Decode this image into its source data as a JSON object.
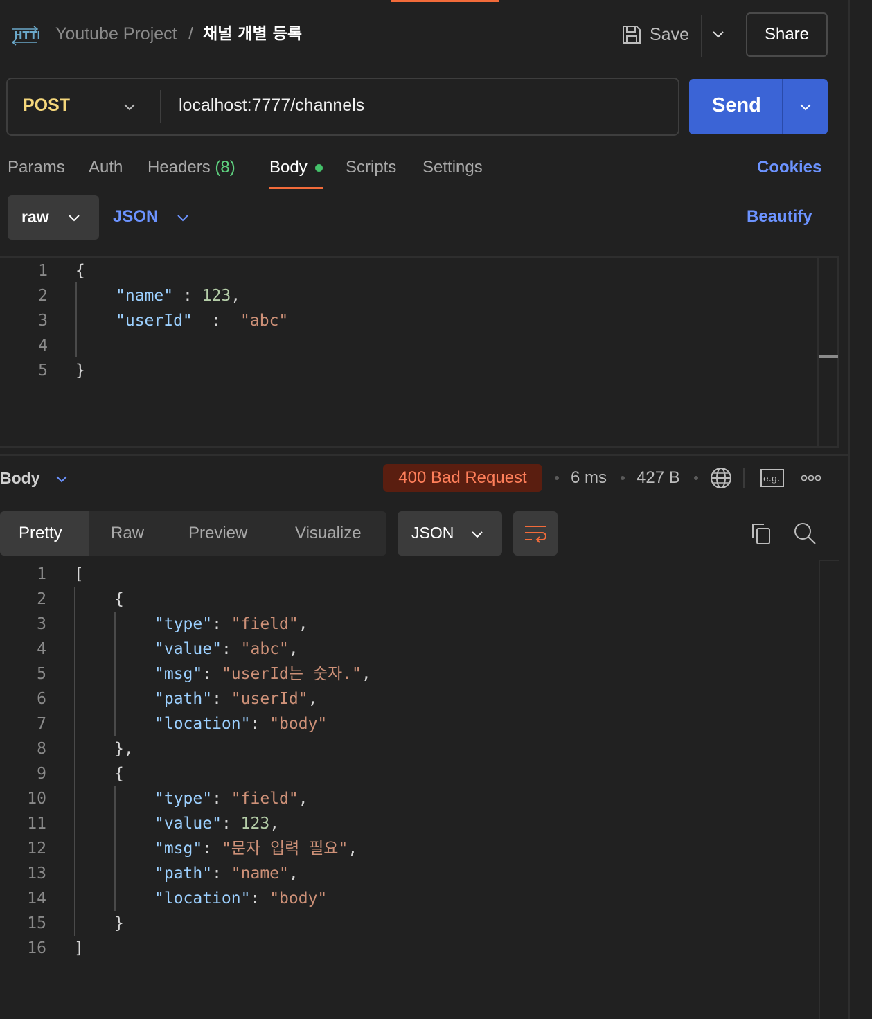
{
  "header": {
    "project": "Youtube Project",
    "separator": "/",
    "title": "채널 개별 등록",
    "save_label": "Save",
    "share_label": "Share"
  },
  "request": {
    "method": "POST",
    "url": "localhost:7777/channels",
    "send_label": "Send"
  },
  "request_tabs": {
    "params": "Params",
    "auth": "Auth",
    "headers": "Headers",
    "headers_count": "(8)",
    "body": "Body",
    "scripts": "Scripts",
    "settings": "Settings",
    "cookies": "Cookies"
  },
  "body_mode": {
    "mode": "raw",
    "format": "JSON",
    "beautify": "Beautify"
  },
  "request_body": {
    "line_numbers": [
      "1",
      "2",
      "3",
      "4",
      "5"
    ],
    "open": "{",
    "close": "}",
    "name_key": "\"name\"",
    "name_value": "123",
    "userid_key": "\"userId\"",
    "userid_value": "\"abc\""
  },
  "response": {
    "view_label": "Body",
    "status": "400 Bad Request",
    "time": "6 ms",
    "size": "427 B",
    "tabs": {
      "pretty": "Pretty",
      "raw": "Raw",
      "preview": "Preview",
      "visualize": "Visualize"
    },
    "format": "JSON",
    "line_numbers": [
      "1",
      "2",
      "3",
      "4",
      "5",
      "6",
      "7",
      "8",
      "9",
      "10",
      "11",
      "12",
      "13",
      "14",
      "15",
      "16"
    ],
    "items": [
      {
        "type": "\"field\"",
        "value": "\"abc\"",
        "msg": "\"userId는 숫자.\"",
        "path": "\"userId\"",
        "location": "\"body\""
      },
      {
        "type": "\"field\"",
        "value": "123",
        "msg": "\"문자 입력 필요\"",
        "path": "\"name\"",
        "location": "\"body\""
      }
    ],
    "keys": {
      "type": "\"type\"",
      "value": "\"value\"",
      "msg": "\"msg\"",
      "path": "\"path\"",
      "location": "\"location\""
    }
  },
  "icons": {
    "http": "http-icon",
    "save": "save-icon",
    "globe": "globe-icon",
    "example": "example-icon",
    "more": "more-icon",
    "wrap": "wrap-lines-icon",
    "copy": "copy-icon",
    "search": "search-icon"
  },
  "colors": {
    "send": "#3b64d6",
    "method": "#f5d77b",
    "link": "#6c93ff",
    "status_bg": "#5a1e10",
    "status_fg": "#ff7f5a",
    "accent": "#f26b3a"
  }
}
